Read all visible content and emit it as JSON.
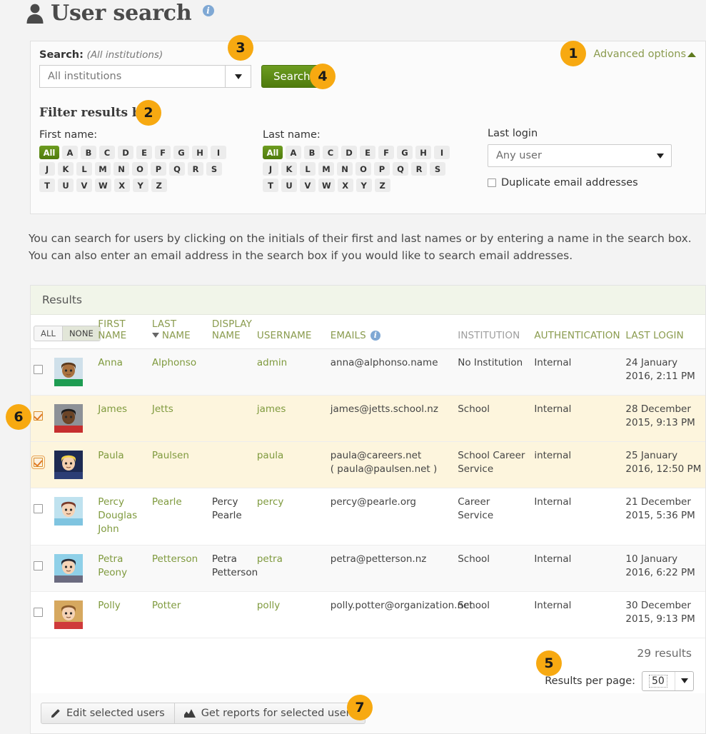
{
  "page": {
    "title": "User search",
    "title_icon": "person-icon",
    "info_icon": "info-icon",
    "help_text": "You can search for users by clicking on the initials of their first and last names or by entering a name in the search box. You can also enter an email address in the search box if you would like to search email addresses."
  },
  "search": {
    "label_prefix": "Search:",
    "label_scope": "(All institutions)",
    "institution_value": "All institutions",
    "search_button": "Search",
    "advanced_options": "Advanced options",
    "advanced_caret_icon": "caret-up-icon"
  },
  "filters": {
    "title": "Filter results by:",
    "first_name_label": "First name:",
    "last_name_label": "Last name:",
    "all_label": "All",
    "letters_row1": [
      "A",
      "B",
      "C",
      "D",
      "E",
      "F",
      "G",
      "H",
      "I"
    ],
    "letters_row2": [
      "J",
      "K",
      "L",
      "M",
      "N",
      "O",
      "P",
      "Q",
      "R",
      "S"
    ],
    "letters_row3": [
      "T",
      "U",
      "V",
      "W",
      "X",
      "Y",
      "Z"
    ],
    "last_login_label": "Last login",
    "last_login_value": "Any user",
    "duplicate_email_label": "Duplicate email addresses"
  },
  "results": {
    "panel_title": "Results",
    "select_all_label": "ALL",
    "select_none_label": "NONE",
    "columns": [
      "FIRST NAME",
      "LAST NAME",
      "DISPLAY NAME",
      "USERNAME",
      "EMAILS",
      "INSTITUTION",
      "AUTHENTICATION",
      "LAST LOGIN"
    ],
    "sorted_column": "LAST NAME",
    "sort_direction": "desc",
    "emails_info_icon": "info-icon",
    "rows": [
      {
        "checked": false,
        "focused": false,
        "avatar": "avatar-anna",
        "first_name": "Anna",
        "last_name": "Alphonso",
        "display_name": "",
        "username": "admin",
        "email": "anna@alphonso.name",
        "email_alt": "",
        "institution": "No Institution",
        "authentication": "Internal",
        "last_login": "24 January 2016, 2:11 PM"
      },
      {
        "checked": true,
        "focused": false,
        "avatar": "avatar-james",
        "first_name": "James",
        "last_name": "Jetts",
        "display_name": "",
        "username": "james",
        "email": "james@jetts.school.nz",
        "email_alt": "",
        "institution": "School",
        "authentication": "Internal",
        "last_login": "28 December 2015, 9:13 PM"
      },
      {
        "checked": true,
        "focused": true,
        "avatar": "avatar-paula",
        "first_name": "Paula",
        "last_name": "Paulsen",
        "display_name": "",
        "username": "paula",
        "email": "paula@careers.net",
        "email_alt": "( paula@paulsen.net )",
        "institution": "School Career Service",
        "authentication": "internal",
        "last_login": "25 January 2016, 12:50 PM"
      },
      {
        "checked": false,
        "focused": false,
        "avatar": "avatar-percy",
        "first_name": "Percy Douglas John",
        "last_name": "Pearle",
        "display_name": "Percy Pearle",
        "username": "percy",
        "email": "percy@pearle.org",
        "email_alt": "",
        "institution": "Career Service",
        "authentication": "Internal",
        "last_login": "21 December 2015, 5:36 PM"
      },
      {
        "checked": false,
        "focused": false,
        "avatar": "avatar-petra",
        "first_name": "Petra Peony",
        "last_name": "Petterson",
        "display_name": "Petra Petterson",
        "username": "petra",
        "email": "petra@petterson.nz",
        "email_alt": "",
        "institution": "School",
        "authentication": "Internal",
        "last_login": "10 January 2016, 6:22 PM"
      },
      {
        "checked": false,
        "focused": false,
        "avatar": "avatar-polly",
        "first_name": "Polly",
        "last_name": "Potter",
        "display_name": "",
        "username": "polly",
        "email": "polly.potter@organization.net",
        "email_alt": "",
        "institution": "School",
        "authentication": "Internal",
        "last_login": "30 December 2015, 9:13 PM"
      }
    ],
    "result_count": "29 results",
    "results_per_page_label": "Results per page:",
    "results_per_page_value": "50"
  },
  "actions": {
    "edit_selected": "Edit selected users",
    "edit_icon": "pencil-icon",
    "get_reports": "Get reports for selected users",
    "reports_icon": "chart-icon"
  },
  "callouts": {
    "one": "1",
    "two": "2",
    "three": "3",
    "four": "4",
    "five": "5",
    "six": "6",
    "seven": "7"
  },
  "colors": {
    "accent_green": "#5c8a16",
    "link_green": "#7f9a3e",
    "badge_orange": "#f7a911",
    "selected_row": "#fdf5dd",
    "panel_bg": "#fbfbfb"
  }
}
